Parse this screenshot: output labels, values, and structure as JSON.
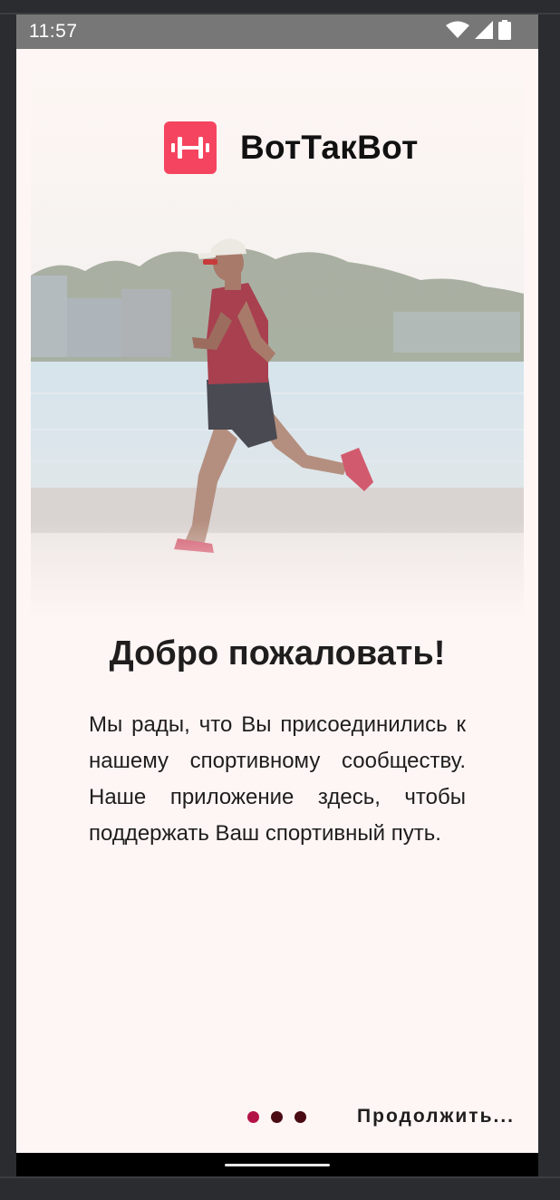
{
  "status_bar": {
    "time": "11:57",
    "icons": [
      "wifi-icon",
      "signal-icon",
      "battery-icon"
    ]
  },
  "brand": {
    "name": "ВотТакВот",
    "logo_icon": "dumbbell-icon",
    "accent_color": "#f5445f"
  },
  "hero_image": {
    "description_icon": "runner-photo"
  },
  "welcome": {
    "title": "Добро пожаловать!",
    "body": "Мы рады, что Вы присоединились к нашему спортивному сообществу. Наше приложение здесь, чтобы поддержать Ваш спортивный путь."
  },
  "pager": {
    "pages": 3,
    "current": 1,
    "active_color": "#b31246",
    "inactive_color": "#4a0a14"
  },
  "actions": {
    "continue_label": "Продолжить..."
  }
}
